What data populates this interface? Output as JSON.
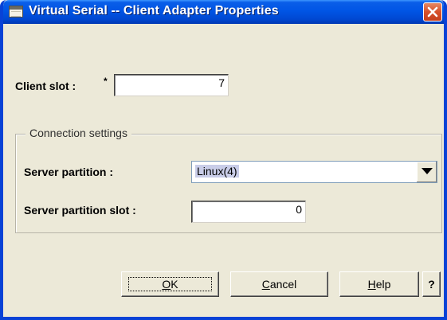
{
  "window": {
    "title": "Virtual Serial -- Client Adapter Properties"
  },
  "client_slot": {
    "label": "Client slot :",
    "required_marker": "*",
    "value": "7"
  },
  "connection_settings": {
    "legend": "Connection settings",
    "server_partition": {
      "label": "Server partition :",
      "selected": "Linux(4)"
    },
    "server_partition_slot": {
      "label": "Server partition slot :",
      "value": "0"
    }
  },
  "buttons": {
    "ok": {
      "mnemonic": "O",
      "rest": "K"
    },
    "cancel": {
      "mnemonic": "C",
      "rest": "ancel"
    },
    "help": {
      "mnemonic": "H",
      "rest": "elp"
    },
    "context_help": "?"
  },
  "icons": {
    "title_icon": "window-icon",
    "close": "close-icon",
    "dropdown": "chevron-down-icon"
  },
  "colors": {
    "titlebar": "#0055e5",
    "window_bg": "#ece9d8",
    "close_button": "#d7502a",
    "selection_highlight": "#c9cde8"
  }
}
